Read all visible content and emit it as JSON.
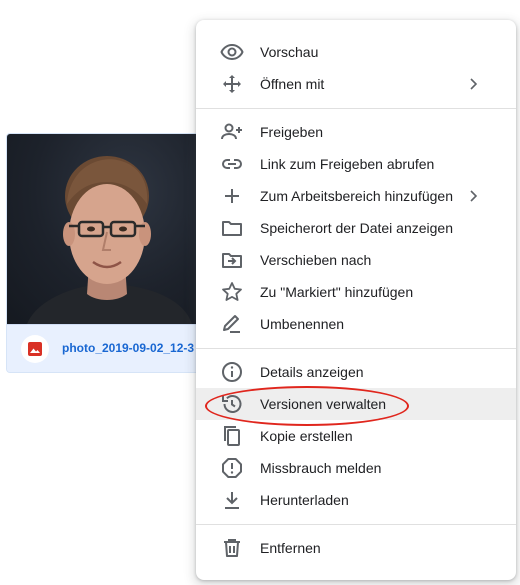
{
  "file": {
    "name": "photo_2019-09-02_12-3",
    "type_icon": "image-file-icon",
    "type_icon_color": "#d93025"
  },
  "menu": {
    "groups": [
      [
        {
          "label": "Vorschau",
          "icon": "eye-icon"
        },
        {
          "label": "Öffnen mit",
          "icon": "move-arrows-icon",
          "submenu": true
        }
      ],
      [
        {
          "label": "Freigeben",
          "icon": "person-add-icon"
        },
        {
          "label": "Link zum Freigeben abrufen",
          "icon": "link-icon"
        },
        {
          "label": "Zum Arbeitsbereich hinzufügen",
          "icon": "plus-icon",
          "submenu": true
        },
        {
          "label": "Speicherort der Datei anzeigen",
          "icon": "folder-icon"
        },
        {
          "label": "Verschieben nach",
          "icon": "move-to-folder-icon"
        },
        {
          "label": "Zu \"Markiert\" hinzufügen",
          "icon": "star-icon"
        },
        {
          "label": "Umbenennen",
          "icon": "pencil-icon"
        }
      ],
      [
        {
          "label": "Details anzeigen",
          "icon": "info-icon"
        },
        {
          "label": "Versionen verwalten",
          "icon": "history-icon",
          "highlighted": true
        },
        {
          "label": "Kopie erstellen",
          "icon": "copy-icon"
        },
        {
          "label": "Missbrauch melden",
          "icon": "report-icon"
        },
        {
          "label": "Herunterladen",
          "icon": "download-icon"
        }
      ],
      [
        {
          "label": "Entfernen",
          "icon": "trash-icon"
        }
      ]
    ]
  },
  "colors": {
    "highlight_ring": "#e0261d",
    "file_name": "#1967d2",
    "icon": "#5f6368"
  }
}
